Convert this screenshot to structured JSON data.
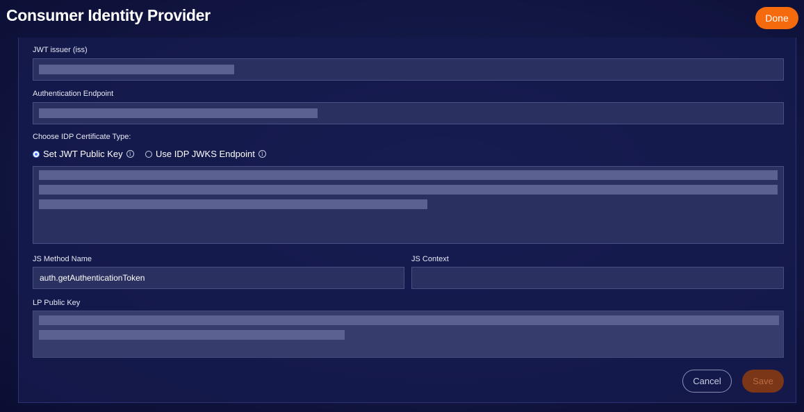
{
  "header": {
    "title": "Consumer Identity Provider",
    "done_label": "Done"
  },
  "form": {
    "jwt_issuer": {
      "label": "JWT issuer (iss)",
      "value_redacted": true
    },
    "auth_endpoint": {
      "label": "Authentication Endpoint",
      "value_redacted": true
    },
    "cert_type": {
      "label": "Choose IDP Certificate Type:",
      "options": [
        {
          "label": "Set JWT Public Key",
          "selected": true
        },
        {
          "label": "Use IDP JWKS Endpoint",
          "selected": false
        }
      ]
    },
    "public_key": {
      "value_redacted": true
    },
    "js_method": {
      "label": "JS Method Name",
      "value": "auth.getAuthenticationToken"
    },
    "js_context": {
      "label": "JS Context",
      "value": ""
    },
    "lp_public_key": {
      "label": "LP Public Key",
      "value_redacted": true,
      "readonly": true
    }
  },
  "actions": {
    "cancel_label": "Cancel",
    "save_label": "Save",
    "save_disabled": true
  },
  "colors": {
    "accent": "#f46a0d",
    "save_disabled": "#7a3616",
    "radio_selected": "#4b7bff"
  }
}
